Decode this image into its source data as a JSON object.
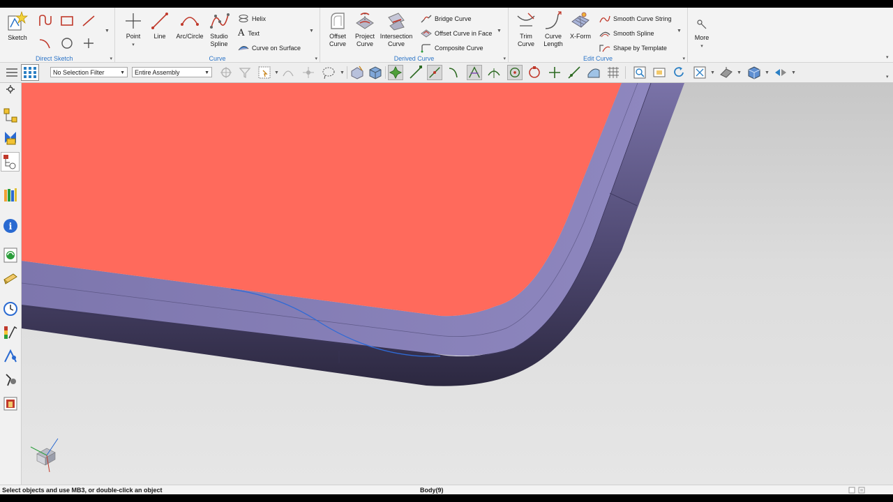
{
  "ribbon": {
    "sketch_label": "Sketch",
    "groups": {
      "direct_sketch": "Direct Sketch",
      "curve": "Curve",
      "derived_curve": "Derived Curve",
      "edit_curve": "Edit Curve"
    },
    "curve_buttons": {
      "point": "Point",
      "line": "Line",
      "arc_circle": "Arc/Circle",
      "studio_spline_1": "Studio",
      "studio_spline_2": "Spline"
    },
    "curve_small": {
      "helix": "Helix",
      "text": "Text",
      "curve_on_surface": "Curve on Surface"
    },
    "derived_buttons": {
      "offset_1": "Offset",
      "offset_2": "Curve",
      "project_1": "Project",
      "project_2": "Curve",
      "intersection_1": "Intersection",
      "intersection_2": "Curve"
    },
    "derived_small": {
      "bridge": "Bridge Curve",
      "offset_in_face": "Offset Curve in Face",
      "composite": "Composite Curve"
    },
    "edit_buttons": {
      "trim_1": "Trim",
      "trim_2": "Curve",
      "length_1": "Curve",
      "length_2": "Length",
      "xform": "X-Form"
    },
    "edit_small": {
      "smooth_string": "Smooth Curve String",
      "smooth_spline": "Smooth Spline",
      "shape_template": "Shape by Template"
    },
    "more_label": "More"
  },
  "toolbar": {
    "selection_filter": "No Selection Filter",
    "scope": "Entire Assembly"
  },
  "status": {
    "prompt": "Select objects and use MB3, or double-click an object",
    "selection": "Body(9)"
  },
  "colors": {
    "face_red": "#ff6a5c",
    "body_purple": "#8f86c2",
    "curve_blue": "#2f6ad6",
    "group_label": "#2b74c7"
  }
}
